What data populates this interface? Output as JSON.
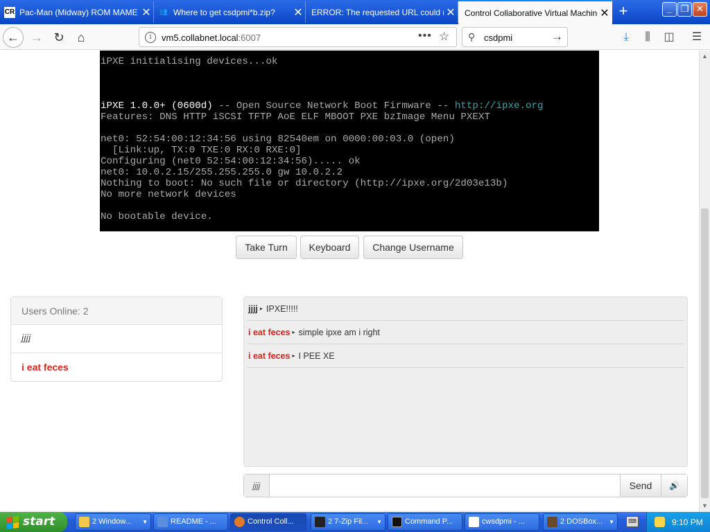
{
  "tabs": [
    {
      "title": "Pac-Man (Midway) ROM MAME - C",
      "icon": "rom-site-icon",
      "fav_text": "CR"
    },
    {
      "title": "Where to get csdpmi*b.zip?",
      "icon": "forum-icon",
      "fav_text": ""
    },
    {
      "title": "ERROR: The requested URL could not",
      "icon": "error-page-icon",
      "fav_text": ""
    },
    {
      "title": "Control Collaborative Virtual Machines",
      "icon": "none",
      "fav_text": ""
    }
  ],
  "nav": {
    "url_host": "vm5.collabnet.local",
    "url_rest": ":6007",
    "search_value": "csdpmi"
  },
  "vm_console": {
    "lines": [
      {
        "text": "iPXE initialising devices...ok",
        "style": ""
      },
      {
        "text": "",
        "style": ""
      },
      {
        "text": "",
        "style": ""
      },
      {
        "text": "",
        "style": ""
      },
      {
        "text": "iPXE 1.0.0+ (0600d)",
        "style": "bright",
        "rest": " -- Open Source Network Boot Firmware -- ",
        "link": "http://ipxe.org"
      },
      {
        "text": "Features: DNS HTTP iSCSI TFTP AoE ELF MBOOT PXE bzImage Menu PXEXT",
        "style": ""
      },
      {
        "text": "",
        "style": ""
      },
      {
        "text": "net0: 52:54:00:12:34:56 using 82540em on 0000:00:03.0 (open)",
        "style": ""
      },
      {
        "text": "  [Link:up, TX:0 TXE:0 RX:0 RXE:0]",
        "style": ""
      },
      {
        "text": "Configuring (net0 52:54:00:12:34:56)..... ok",
        "style": ""
      },
      {
        "text": "net0: 10.0.2.15/255.255.255.0 gw 10.0.2.2",
        "style": ""
      },
      {
        "text": "Nothing to boot: No such file or directory (http://ipxe.org/2d03e13b)",
        "style": ""
      },
      {
        "text": "No more network devices",
        "style": ""
      },
      {
        "text": "",
        "style": ""
      },
      {
        "text": "No bootable device.",
        "style": ""
      }
    ]
  },
  "controls": {
    "take_turn": "Take Turn",
    "keyboard": "Keyboard",
    "change_username": "Change Username"
  },
  "users": {
    "header": "Users Online: 2",
    "list": [
      {
        "name": "jjjj",
        "style": "you"
      },
      {
        "name": "i eat feces",
        "style": "red"
      }
    ]
  },
  "chat": {
    "messages": [
      {
        "user": "jjjj",
        "text": "IPXE!!!!!",
        "style": ""
      },
      {
        "user": "i eat feces",
        "text": "simple ipxe am i right",
        "style": "red"
      },
      {
        "user": "i eat feces",
        "text": "I PEE XE",
        "style": "red"
      }
    ],
    "nick": "jjjj",
    "input_value": "",
    "send_label": "Send",
    "sound_icon": "speaker-icon"
  },
  "taskbar": {
    "start_label": "start",
    "items": [
      {
        "label": "2 Window...",
        "icon_color": "#f0c84a",
        "dropdown": true
      },
      {
        "label": "README - ...",
        "icon_color": "#5a8fe0",
        "dropdown": false
      },
      {
        "label": "Control Coll...",
        "icon_color": "#e07a2a",
        "dropdown": false,
        "active": true
      },
      {
        "label": "2 7-Zip Fil...",
        "icon_color": "#222222",
        "dropdown": true
      },
      {
        "label": "Command P...",
        "icon_color": "#111111",
        "dropdown": false
      },
      {
        "label": "cwsdpmi - ...",
        "icon_color": "#ffffff",
        "dropdown": false
      },
      {
        "label": "2 DOSBox...",
        "icon_color": "#6b4a2a",
        "dropdown": true
      }
    ],
    "clock": "9:10 PM"
  },
  "colors": {
    "accent": "#0a84ff",
    "username_red": "#d9231f",
    "console_link": "#2ea8a8"
  }
}
